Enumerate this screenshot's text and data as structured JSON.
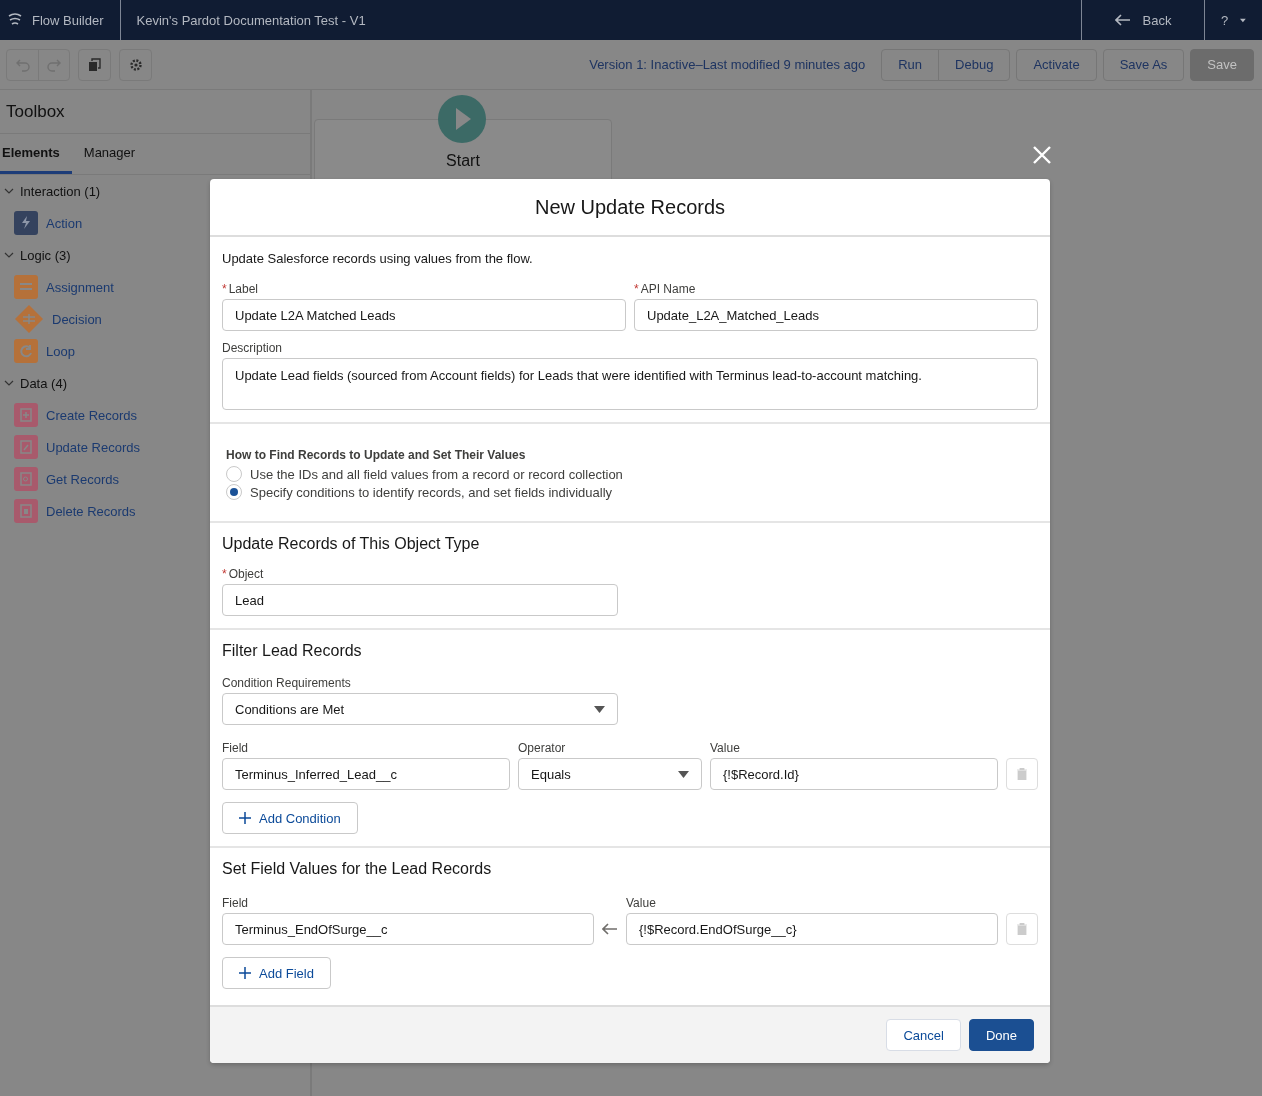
{
  "app_bar": {
    "app_name": "Flow Builder",
    "flow_title": "Kevin's Pardot Documentation Test - V1",
    "back": "Back",
    "help": "?"
  },
  "toolbar": {
    "status": "Version 1: Inactive–Last modified 9 minutes ago",
    "buttons": [
      {
        "label": "Run",
        "disabled": false
      },
      {
        "label": "Debug",
        "disabled": false
      },
      {
        "label": "Activate",
        "disabled": false
      },
      {
        "label": "Save As",
        "disabled": false
      },
      {
        "label": "Save",
        "disabled": true
      }
    ]
  },
  "toolbox": {
    "title": "Toolbox",
    "tabs": [
      {
        "label": "Elements",
        "selected": true
      },
      {
        "label": "Manager",
        "selected": false
      }
    ],
    "groups": [
      {
        "label": "Interaction (1)",
        "expanded": true,
        "items": [
          {
            "label": "Action",
            "kind": "action"
          }
        ]
      },
      {
        "label": "Logic (3)",
        "expanded": true,
        "items": [
          {
            "label": "Assignment",
            "kind": "assignment"
          },
          {
            "label": "Decision",
            "kind": "decision"
          },
          {
            "label": "Loop",
            "kind": "loop"
          }
        ]
      },
      {
        "label": "Data (4)",
        "expanded": true,
        "items": [
          {
            "label": "Create Records",
            "kind": "create"
          },
          {
            "label": "Update Records",
            "kind": "update"
          },
          {
            "label": "Get Records",
            "kind": "get"
          },
          {
            "label": "Delete Records",
            "kind": "delete"
          }
        ]
      }
    ]
  },
  "canvas": {
    "start_label": "Start"
  },
  "modal": {
    "title": "New Update Records",
    "intro": "Update Salesforce records using values from the flow.",
    "label_field": {
      "label": "Label",
      "required_marker": "*",
      "value": "Update L2A Matched Leads"
    },
    "api_name_field": {
      "label": "API Name",
      "required_marker": "*",
      "value": "Update_L2A_Matched_Leads"
    },
    "description_field": {
      "label": "Description",
      "value": "Update Lead fields (sourced from Account fields) for Leads that were identified with Terminus lead-to-account matching."
    },
    "find_records": {
      "heading": "How to Find Records to Update and Set Their Values",
      "options": [
        {
          "label": "Use the IDs and all field values from a record or record collection",
          "selected": false
        },
        {
          "label": "Specify conditions to identify records, and set fields individually",
          "selected": true
        }
      ]
    },
    "object_section": {
      "heading": "Update Records of This Object Type",
      "field": {
        "label": "Object",
        "required_marker": "*",
        "value": "Lead"
      }
    },
    "filter_section": {
      "heading": "Filter Lead Records",
      "requirements_label": "Condition Requirements",
      "requirements_value": "Conditions are Met",
      "column_labels": {
        "field": "Field",
        "operator": "Operator",
        "value": "Value"
      },
      "conditions": [
        {
          "field": "Terminus_Inferred_Lead__c",
          "operator": "Equals",
          "value": "{!$Record.Id}"
        }
      ],
      "add_button": "Add Condition"
    },
    "set_fields_section": {
      "heading": "Set Field Values for the Lead Records",
      "column_labels": {
        "field": "Field",
        "value": "Value"
      },
      "assignments": [
        {
          "field": "Terminus_EndOfSurge__c",
          "value": "{!$Record.EndOfSurge__c}"
        }
      ],
      "add_button": "Add Field"
    },
    "footer": {
      "cancel": "Cancel",
      "done": "Done"
    }
  }
}
